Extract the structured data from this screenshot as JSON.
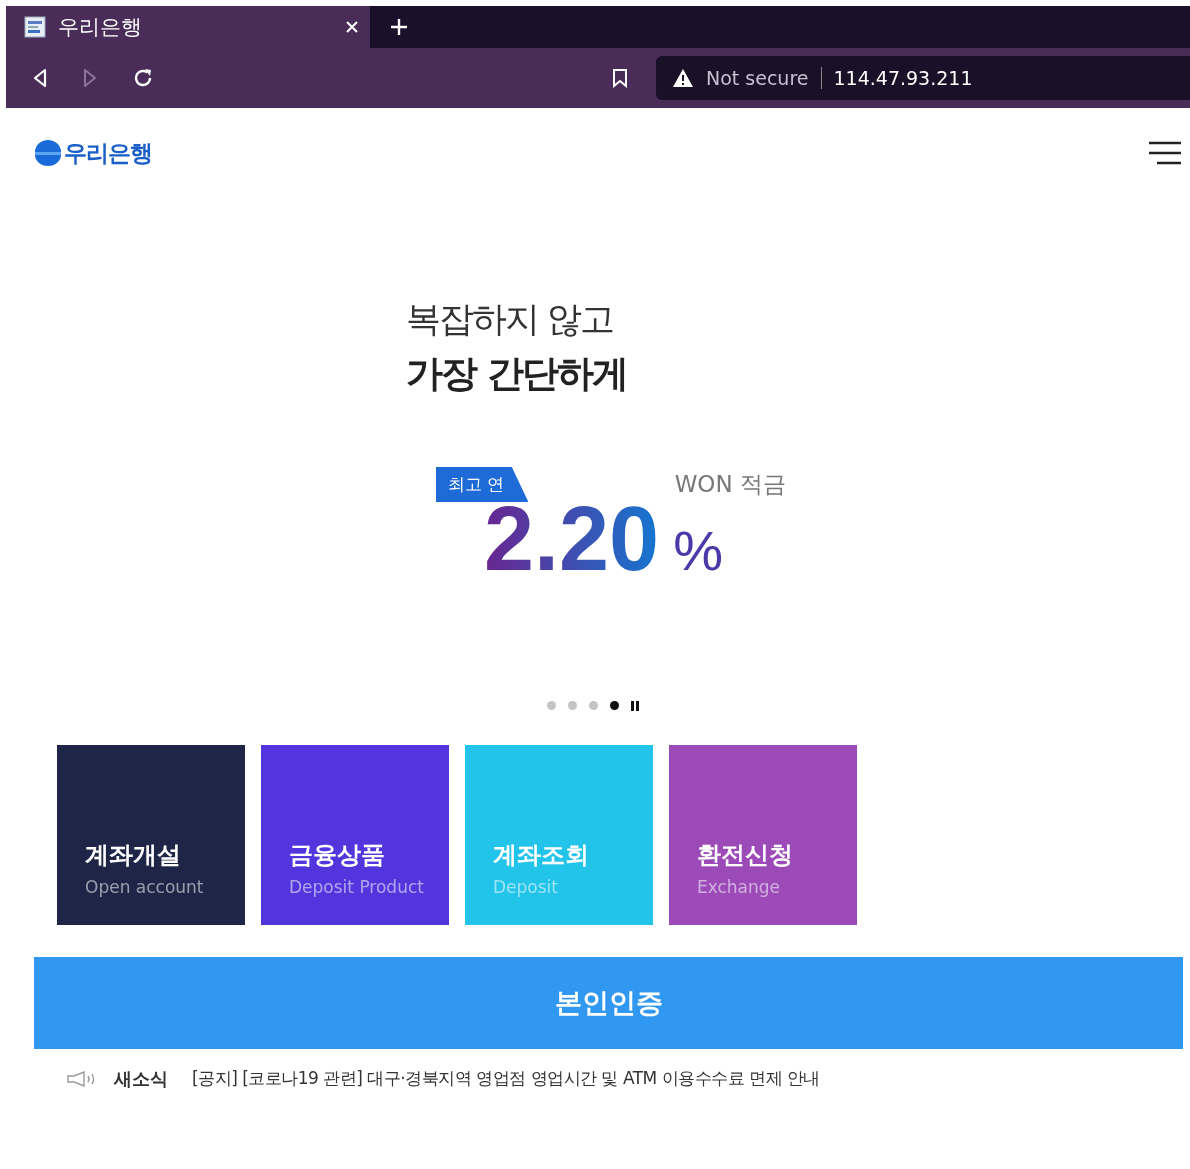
{
  "browser": {
    "tab_title": "우리은행",
    "security_label": "Not secure",
    "url": "114.47.93.211"
  },
  "header": {
    "logo_text": "우리은행"
  },
  "hero": {
    "line_1": "복잡하지 않고",
    "line_2": "가장 간단하게",
    "badge": "최고 연",
    "product": "WON 적금",
    "rate": "2.20",
    "unit": "%"
  },
  "slides": [
    {
      "selected": false
    },
    {
      "selected": false
    },
    {
      "selected": false
    },
    {
      "selected": true
    }
  ],
  "tiles": [
    {
      "title": "계좌개설",
      "subtitle": "Open account",
      "color": "#1e2547"
    },
    {
      "title": "금융상품",
      "subtitle": "Deposit Product",
      "color": "#5235dc"
    },
    {
      "title": "계좌조회",
      "subtitle": "Deposit",
      "color": "#23c4e9"
    },
    {
      "title": "환전신청",
      "subtitle": "Exchange",
      "color": "#9c4ab8"
    }
  ],
  "verify_button": "본인인증",
  "news": {
    "label": "새소식",
    "text": "[공지] [코로나19 관련] 대구·경북지역 영업점 영업시간 및 ATM 이용수수료 면제 안내"
  }
}
